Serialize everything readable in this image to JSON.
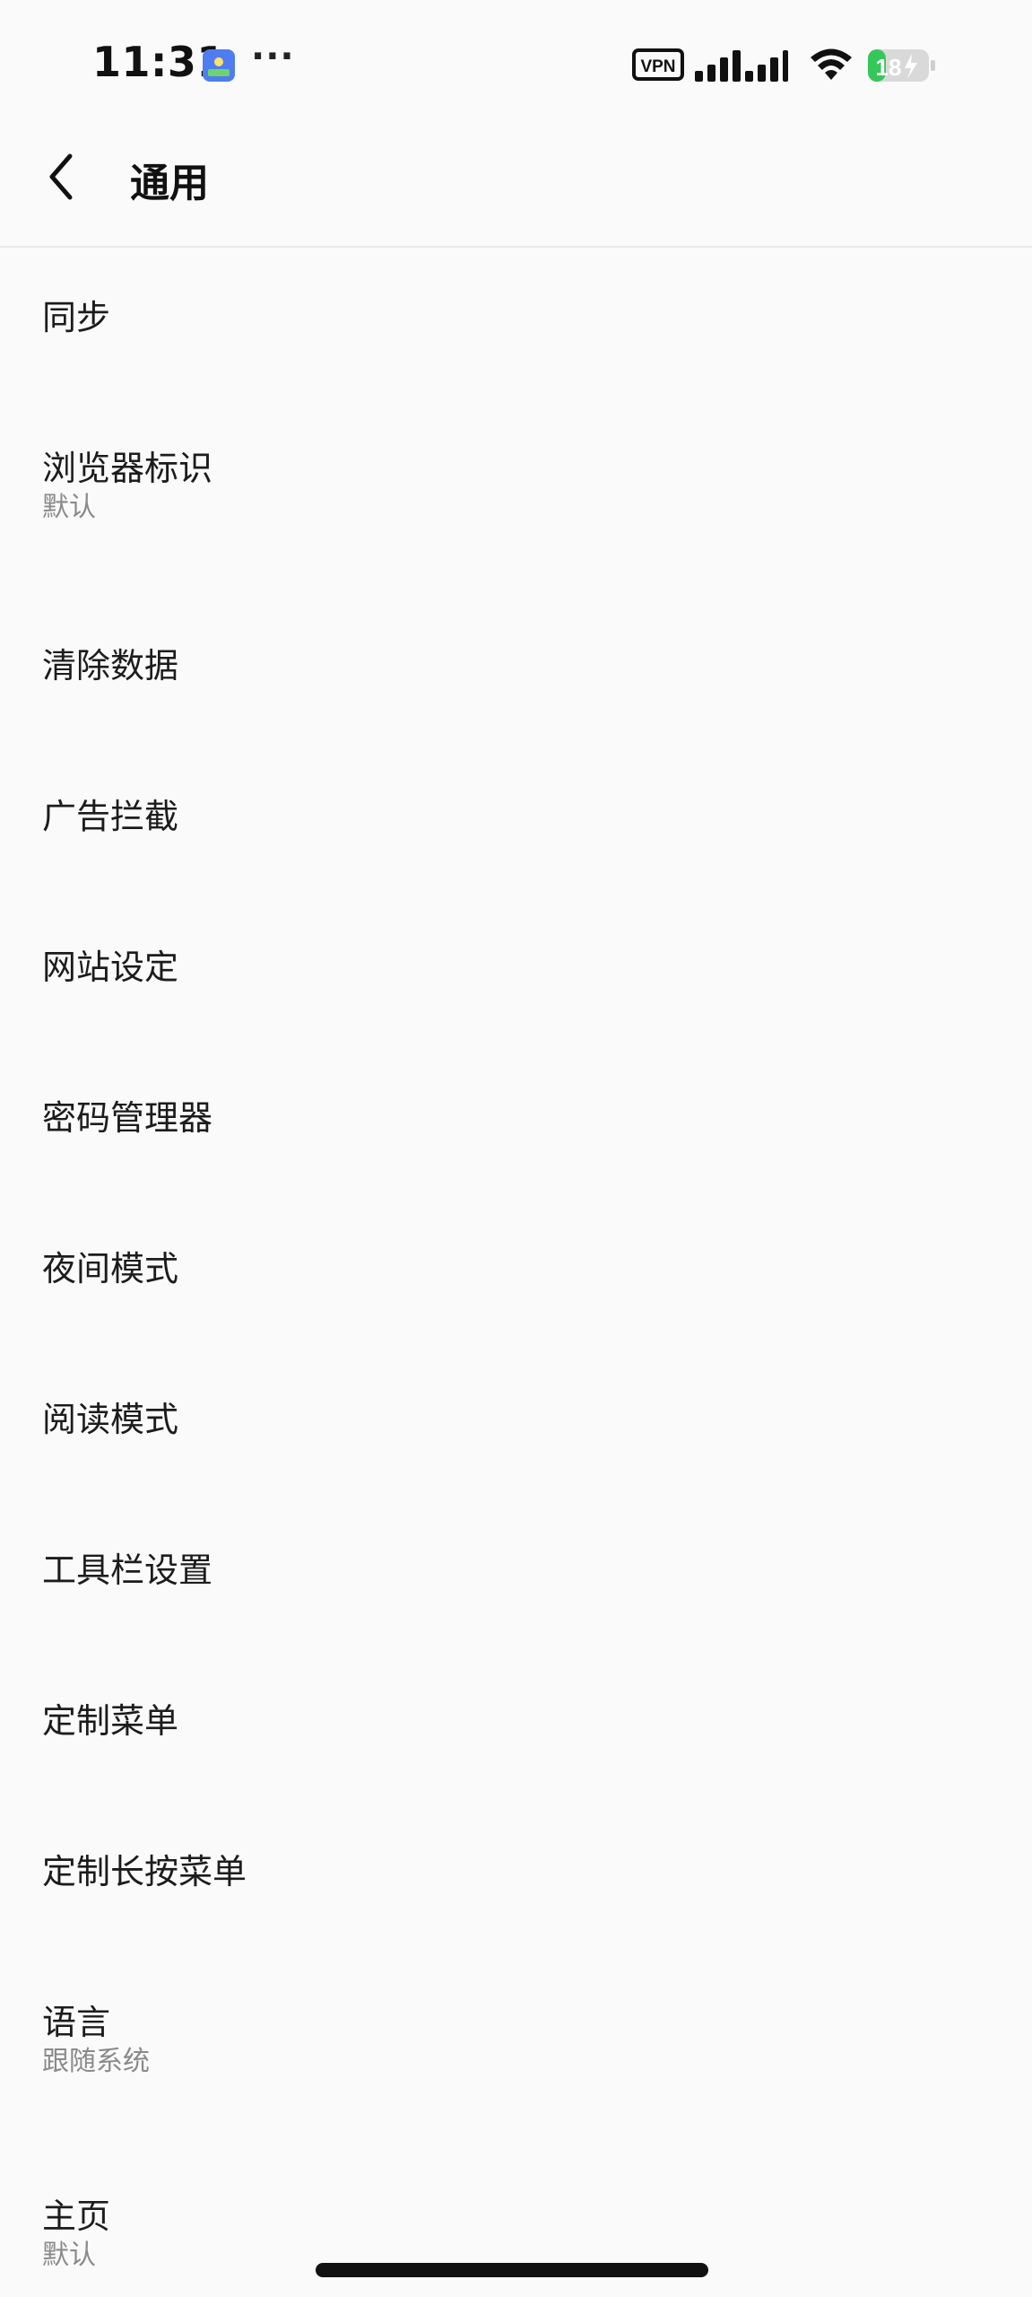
{
  "status_bar": {
    "time": "11:31",
    "more": "···",
    "vpn_label": "VPN",
    "battery_level": "18",
    "battery_color": "#35c759"
  },
  "header": {
    "title": "通用"
  },
  "settings": [
    {
      "title": "同步"
    },
    {
      "title": "浏览器标识",
      "subtitle": "默认"
    },
    {
      "title": "清除数据"
    },
    {
      "title": "广告拦截"
    },
    {
      "title": "网站设定"
    },
    {
      "title": "密码管理器"
    },
    {
      "title": "夜间模式"
    },
    {
      "title": "阅读模式"
    },
    {
      "title": "工具栏设置"
    },
    {
      "title": "定制菜单"
    },
    {
      "title": "定制长按菜单"
    },
    {
      "title": "语言",
      "subtitle": "跟随系统"
    },
    {
      "title": "主页",
      "subtitle": "默认"
    }
  ]
}
